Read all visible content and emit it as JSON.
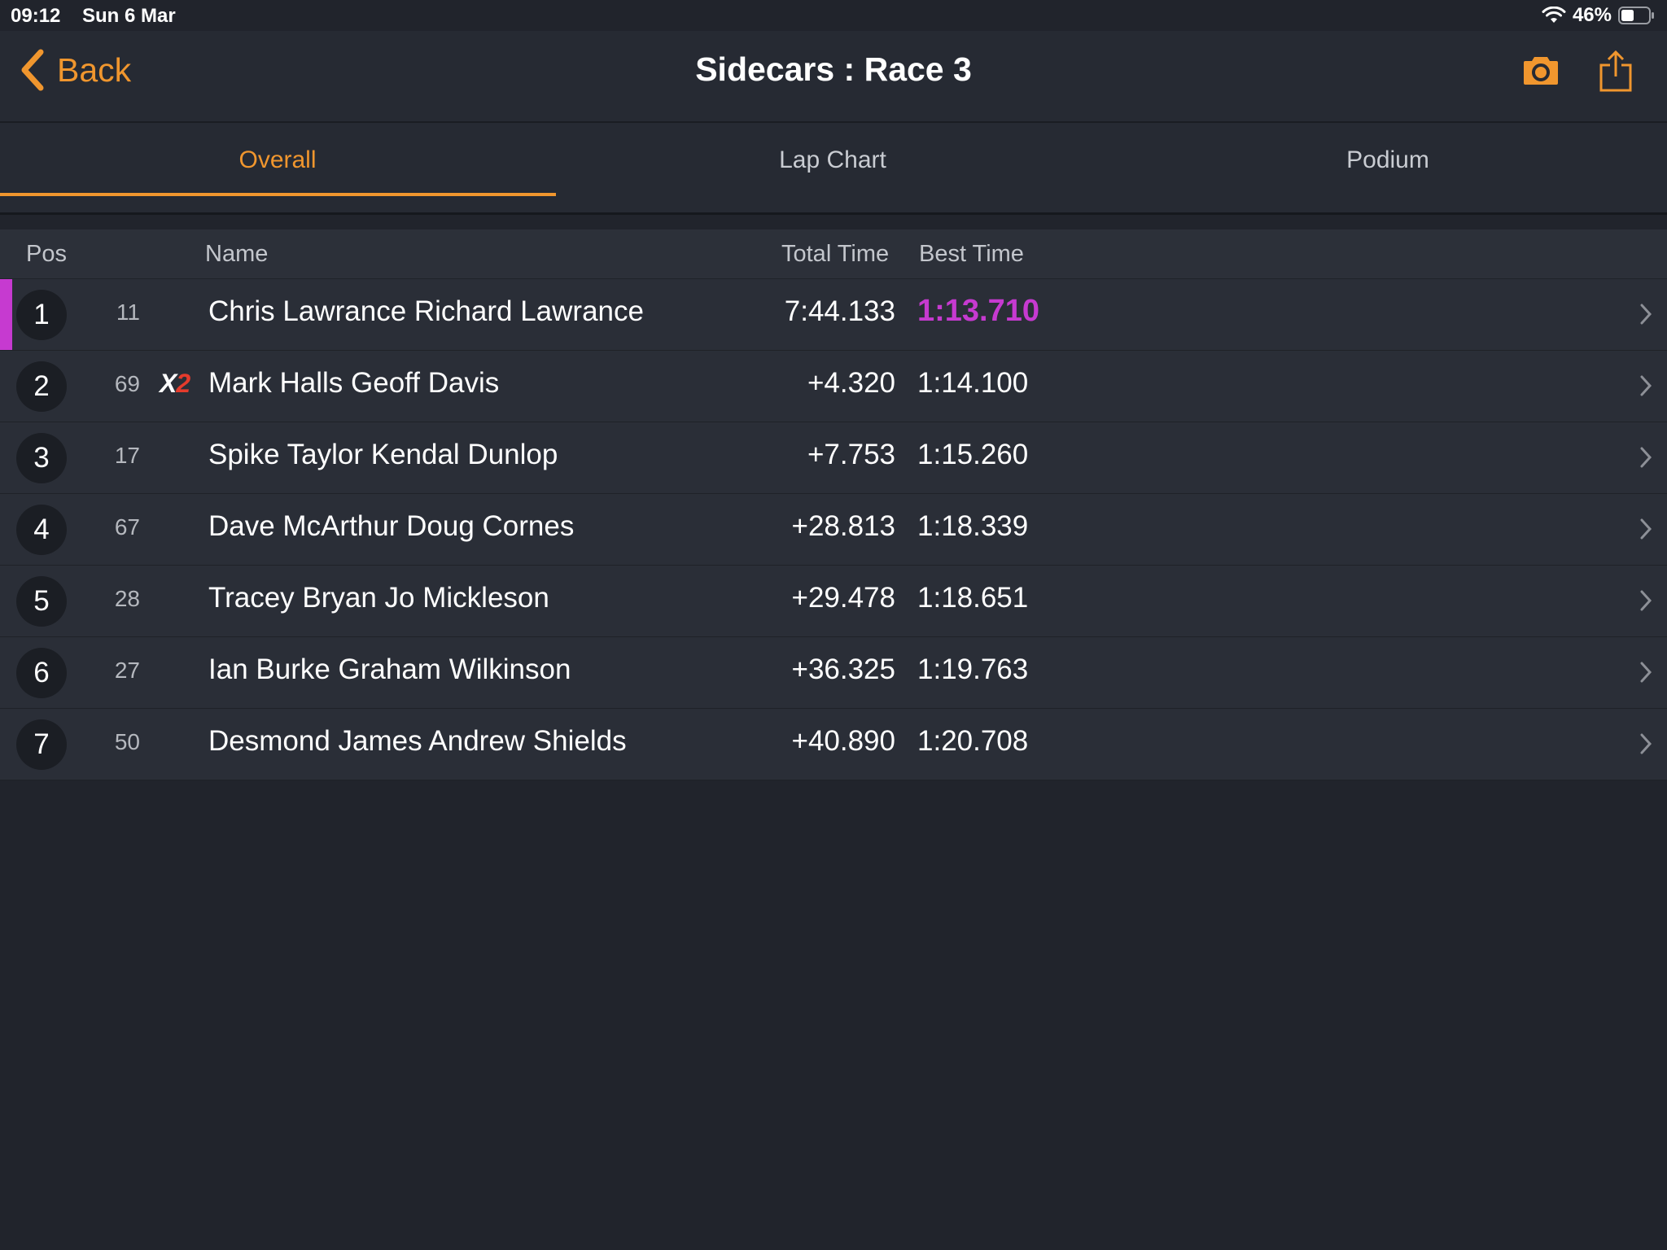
{
  "status_bar": {
    "time": "09:12",
    "date": "Sun 6 Mar",
    "battery": "46%"
  },
  "nav": {
    "back_label": "Back",
    "title": "Sidecars : Race 3",
    "accent_color": "#f0962e"
  },
  "tabs": [
    {
      "label": "Overall",
      "selected": true
    },
    {
      "label": "Lap Chart",
      "selected": false
    },
    {
      "label": "Podium",
      "selected": false
    }
  ],
  "table": {
    "headers": {
      "pos": "Pos",
      "name": "Name",
      "total_time": "Total Time",
      "best_time": "Best Time"
    },
    "fastest_lap_color": "#c63ad0",
    "rows": [
      {
        "pos": "1",
        "number": "11",
        "badge": "",
        "name": "Chris Lawrance Richard Lawrance",
        "total_time": "7:44.133",
        "best_time": "1:13.710",
        "fastest": true
      },
      {
        "pos": "2",
        "number": "69",
        "badge": "X2",
        "name": "Mark Halls Geoff Davis",
        "total_time": "+4.320",
        "best_time": "1:14.100",
        "fastest": false
      },
      {
        "pos": "3",
        "number": "17",
        "badge": "",
        "name": "Spike Taylor Kendal Dunlop",
        "total_time": "+7.753",
        "best_time": "1:15.260",
        "fastest": false
      },
      {
        "pos": "4",
        "number": "67",
        "badge": "",
        "name": "Dave McArthur Doug Cornes",
        "total_time": "+28.813",
        "best_time": "1:18.339",
        "fastest": false
      },
      {
        "pos": "5",
        "number": "28",
        "badge": "",
        "name": "Tracey Bryan Jo Mickleson",
        "total_time": "+29.478",
        "best_time": "1:18.651",
        "fastest": false
      },
      {
        "pos": "6",
        "number": "27",
        "badge": "",
        "name": "Ian Burke Graham Wilkinson",
        "total_time": "+36.325",
        "best_time": "1:19.763",
        "fastest": false
      },
      {
        "pos": "7",
        "number": "50",
        "badge": "",
        "name": "Desmond James Andrew Shields",
        "total_time": "+40.890",
        "best_time": "1:20.708",
        "fastest": false
      }
    ]
  }
}
